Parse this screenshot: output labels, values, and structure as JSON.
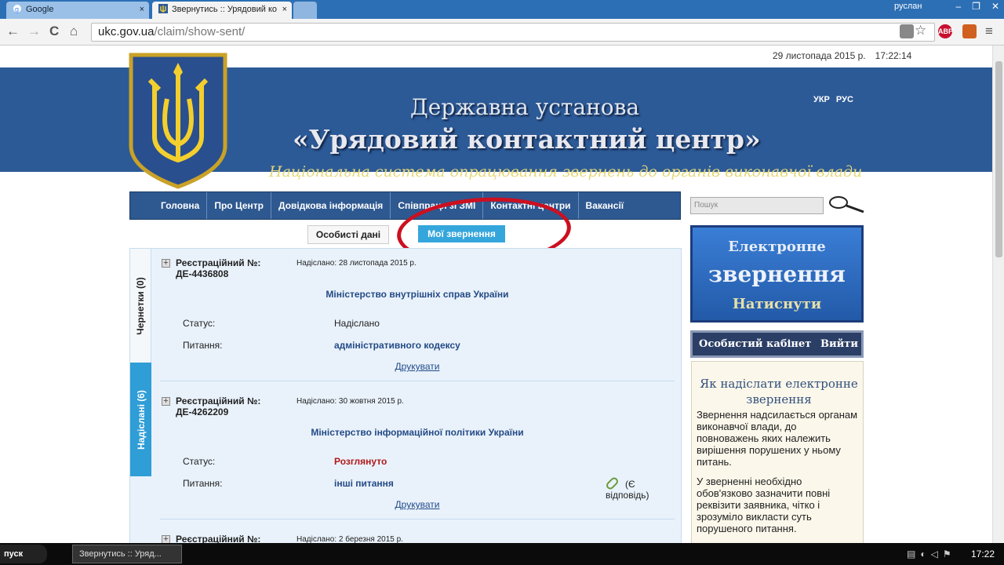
{
  "browser": {
    "tabs": [
      {
        "label": "Google",
        "close": "×"
      },
      {
        "label": "Звернутись :: Урядовий ко",
        "close": "×"
      }
    ],
    "window_user": "руслан",
    "window_buttons": [
      "–",
      "❐",
      "✕"
    ],
    "url_host": "ukc.gov.ua",
    "url_path": "/claim/show-sent/",
    "nav": {
      "back": "←",
      "forward": "→",
      "reload": "C",
      "home": "⌂"
    },
    "ext_abp": "ABP"
  },
  "site": {
    "date": "29 листопада 2015 р.",
    "time": "17:22:14",
    "title1": "Державна установа",
    "title2": "«Урядовий контактний центр»",
    "title3": "Національна система опрацювання звернень до органів виконавчої влади",
    "langs": [
      "УКР",
      "РУС"
    ],
    "menu": [
      "Головна",
      "Про Центр",
      "Довідкова інформація",
      "Співпраця зі ЗМІ",
      "Контактні центри",
      "Вакансії"
    ],
    "subtabs": {
      "personal": "Особисті дані",
      "my": "Мої звернення"
    },
    "sidetabs": {
      "drafts": "Чернетки (0)",
      "sent": "Надіслані (6)"
    },
    "status_label": "Статус:",
    "question_label": "Питання:",
    "print_label": "Друкувати",
    "entries": [
      {
        "reg": "Реєстраційний №:",
        "num": "ДЕ-4436808",
        "sent": "Надіслано: 28 листопада 2015 р.",
        "org": "Міністерство внутрішніх справ України",
        "status": "Надіслано",
        "question": "адміністративного кодексу"
      },
      {
        "reg": "Реєстраційний №:",
        "num": "ДЕ-4262209",
        "sent": "Надіслано: 30 жовтня 2015 р.",
        "org": "Міністерство інформаційної політики України",
        "status": "Розглянуто",
        "question": "інші питання",
        "attachment": "(Є відповідь)"
      },
      {
        "reg": "Реєстраційний №:",
        "num": "",
        "sent": "Надіслано: 2 березня 2015 р.",
        "org": "",
        "status": "",
        "question": ""
      }
    ],
    "search_placeholder": "Пошук",
    "ebox": {
      "line1": "Електронне",
      "line2": "звернення",
      "line3": "Натиснути"
    },
    "cabinet": {
      "label": "Особистий кабінет",
      "exit": "Вийти"
    },
    "how": {
      "title": "Як надіслати електронне звернення",
      "p1": "Звернення надсилається органам виконавчої влади, до повноважень яких належить вирішення порушених у ньому питань.",
      "p2": "У зверненні необхідно обов'язково зазначити повні реквізити заявника, чітко і зрозуміло викласти суть порушеного питання."
    }
  },
  "taskbar": {
    "start": "пуск",
    "task": "Звернутись :: Уряд...",
    "clock": "17:22"
  },
  "colors": {
    "header_blue": "#2c5a96",
    "accent_tab": "#35a6dc",
    "status_red": "#b01818",
    "circle": "#cc1020"
  }
}
